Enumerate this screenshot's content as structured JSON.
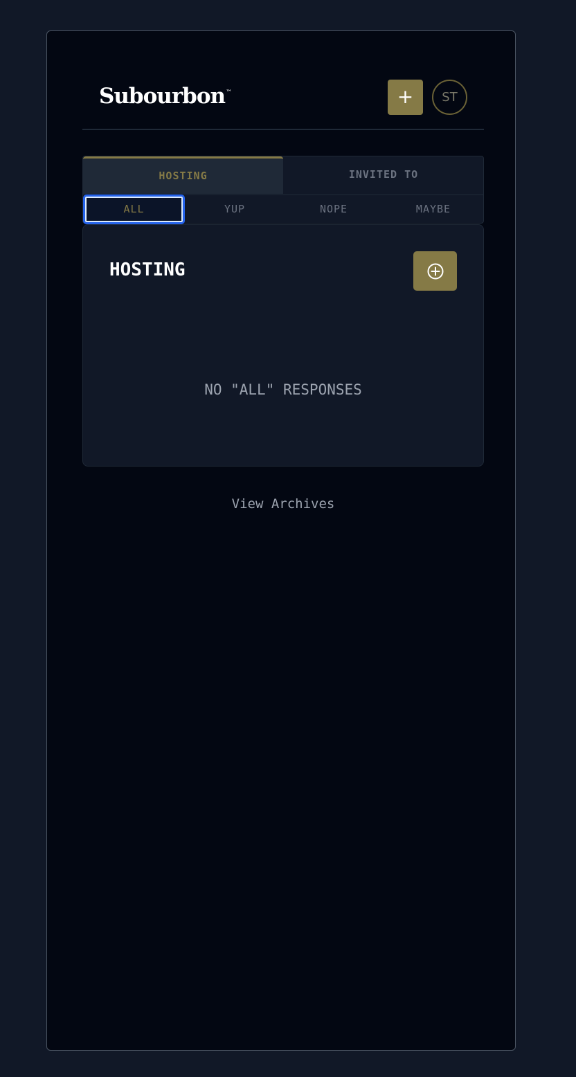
{
  "header": {
    "logo": "Subourbon",
    "trademark": "™",
    "add_label": "+",
    "avatar_initials": "ST"
  },
  "tabs": {
    "hosting": "HOSTING",
    "invited": "INVITED TO"
  },
  "filters": [
    {
      "label": "ALL",
      "active": true
    },
    {
      "label": "YUP",
      "active": false
    },
    {
      "label": "NOPE",
      "active": false
    },
    {
      "label": "MAYBE",
      "active": false
    }
  ],
  "panel": {
    "title": "HOSTING",
    "empty_message": "NO \"ALL\" RESPONSES",
    "add_icon": "plus-circle-icon"
  },
  "footer": {
    "archives_link": "View Archives"
  },
  "colors": {
    "accent": "#857a46",
    "background": "#030712",
    "page": "#111827",
    "focus": "#2563eb"
  }
}
